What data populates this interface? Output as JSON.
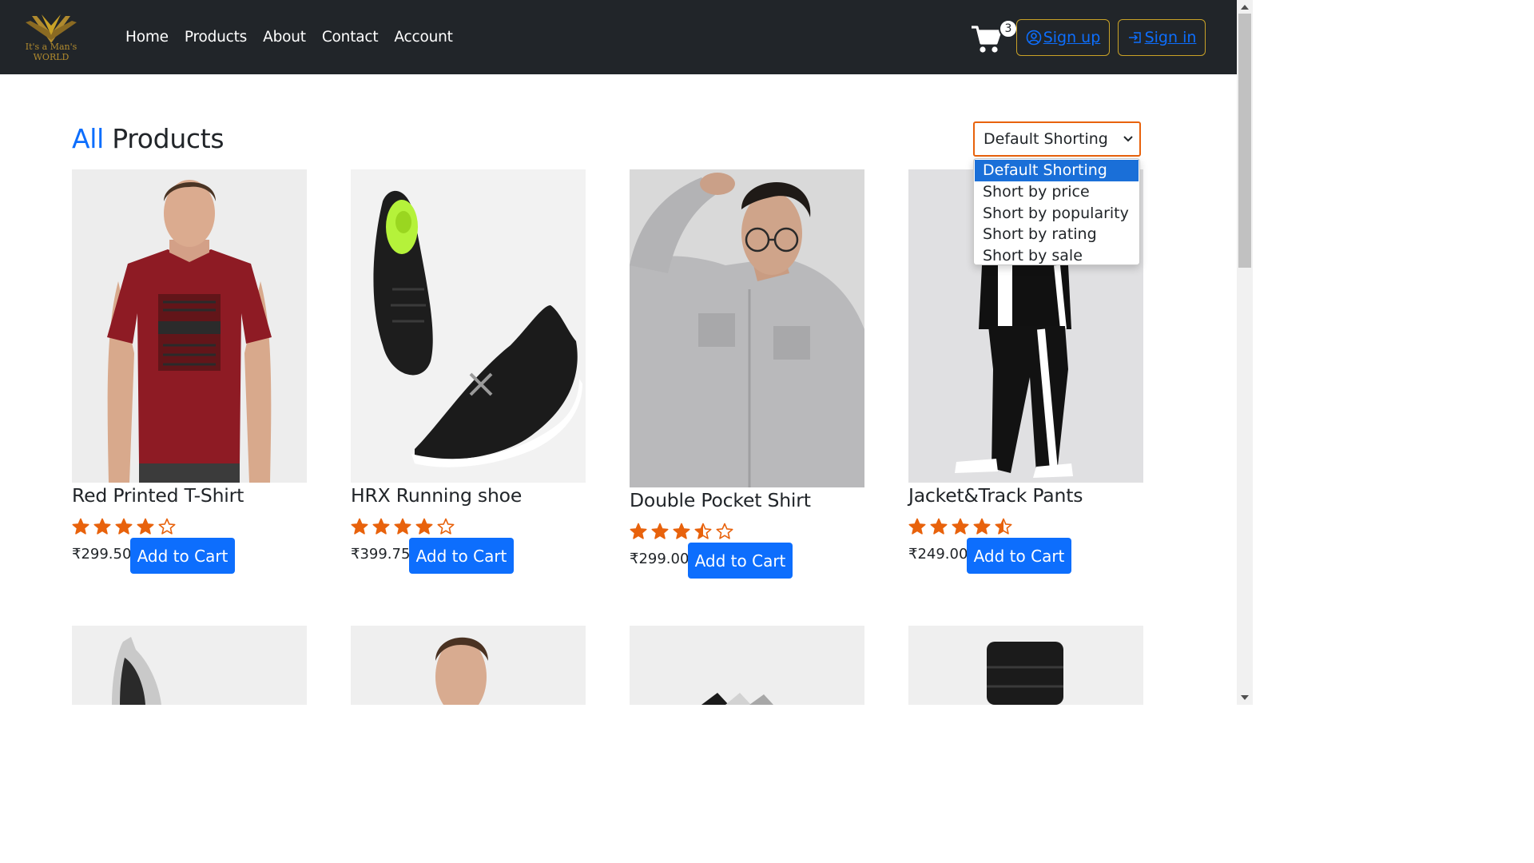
{
  "brand": {
    "logo_line1": "It's a Man's",
    "logo_line2": "WORLD",
    "logo_color": "#b08a2e"
  },
  "nav": {
    "links": [
      "Home",
      "Products",
      "About",
      "Contact",
      "Account"
    ]
  },
  "cart": {
    "count": "3",
    "icon": "cart-icon"
  },
  "auth": {
    "signup_label": "Sign up",
    "signin_label": "Sign in",
    "signup_icon": "person-circle-icon",
    "signin_icon": "box-arrow-in-right-icon"
  },
  "page": {
    "title_accent": "All",
    "title_rest": "Products"
  },
  "sort": {
    "selected": "Default Shorting",
    "options": [
      "Default Shorting",
      "Short by price",
      "Short by popularity",
      "Short by rating",
      "Short by sale"
    ]
  },
  "products": [
    {
      "name": "Red Printed T-Shirt",
      "price": "₹299.50",
      "rating": 4,
      "button": "Add to Cart"
    },
    {
      "name": "HRX Running shoe",
      "price": "₹399.75",
      "rating": 4,
      "button": "Add to Cart"
    },
    {
      "name": "Double Pocket Shirt",
      "price": "₹299.00",
      "rating": 3.5,
      "button": "Add to Cart"
    },
    {
      "name": "Jacket&Track Pants",
      "price": "₹249.00",
      "rating": 4.5,
      "button": "Add to Cart"
    }
  ],
  "colors": {
    "navbar": "#212529",
    "primary": "#0d6efd",
    "star": "#e8620c",
    "select_border": "#e8620c",
    "auth_border": "#c9a227"
  }
}
